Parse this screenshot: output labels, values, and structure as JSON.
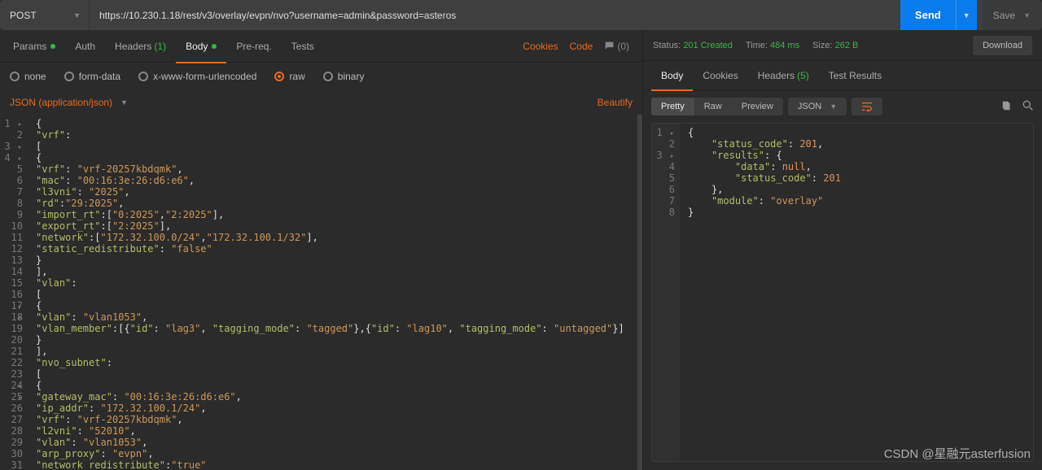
{
  "top": {
    "method": "POST",
    "url": "https://10.230.1.18/rest/v3/overlay/evpn/nvo?username=admin&password=asteros",
    "send": "Send",
    "save": "Save"
  },
  "req_tabs": {
    "params": "Params",
    "auth": "Auth",
    "headers": "Headers",
    "headers_count": "(1)",
    "body": "Body",
    "prereq": "Pre-req.",
    "tests": "Tests",
    "cookies_link": "Cookies",
    "code_link": "Code",
    "comments": "(0)"
  },
  "body_type": {
    "none": "none",
    "form_data": "form-data",
    "xwww": "x-www-form-urlencoded",
    "raw": "raw",
    "binary": "binary"
  },
  "content_type": "JSON (application/json)",
  "beautify": "Beautify",
  "request_json_lines": [
    "{",
    "\"vrf\":",
    "[",
    "{",
    "\"vrf\": \"vrf-20257kbdqmk\",",
    "\"mac\": \"00:16:3e:26:d6:e6\",",
    "\"l3vni\": \"2025\",",
    "\"rd\":\"29:2025\",",
    "\"import_rt\":[\"0:2025\",\"2:2025\"],",
    "\"export_rt\":[\"2:2025\"],",
    "\"network\":[\"172.32.100.0/24\",\"172.32.100.1/32\"],",
    "\"static_redistribute\": \"false\"",
    "}",
    "],",
    "\"vlan\":",
    "[",
    "{",
    "\"vlan\": \"vlan1053\",",
    "\"vlan_member\":[{\"id\": \"lag3\", \"tagging_mode\": \"tagged\"},{\"id\": \"lag10\", \"tagging_mode\": \"untagged\"}]",
    "}",
    "],",
    "\"nvo_subnet\":",
    "[",
    "{",
    "\"gateway_mac\": \"00:16:3e:26:d6:e6\",",
    "\"ip_addr\": \"172.32.100.1/24\",",
    "\"vrf\": \"vrf-20257kbdqmk\",",
    "\"l2vni\": \"52010\",",
    "\"vlan\": \"vlan1053\",",
    "\"arp_proxy\": \"evpn\",",
    "\"network_redistribute\":\"true\""
  ],
  "status_row": {
    "status_label": "Status:",
    "status_value": "201 Created",
    "time_label": "Time:",
    "time_value": "484 ms",
    "size_label": "Size:",
    "size_value": "262 B",
    "download": "Download"
  },
  "resp_tabs": {
    "body": "Body",
    "cookies": "Cookies",
    "headers": "Headers",
    "headers_count": "(5)",
    "tests": "Test Results"
  },
  "resp_toolbar": {
    "pretty": "Pretty",
    "raw": "Raw",
    "preview": "Preview",
    "json": "JSON"
  },
  "response_json_lines": [
    "{",
    "    \"status_code\": 201,",
    "    \"results\": {",
    "        \"data\": null,",
    "        \"status_code\": 201",
    "    },",
    "    \"module\": \"overlay\"",
    "}"
  ],
  "watermark": "CSDN @星融元asterfusion",
  "chart_data": null
}
